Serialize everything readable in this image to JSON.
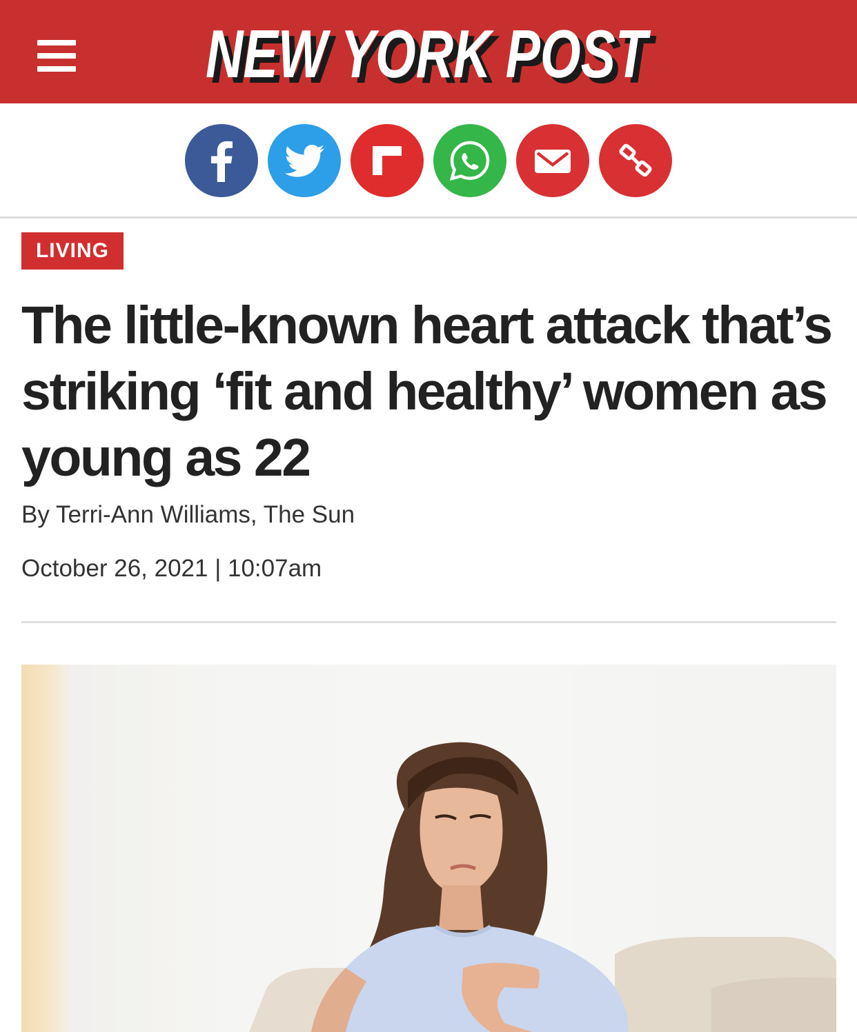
{
  "header": {
    "logo_text": "NEW YORK POST",
    "menu_icon": "hamburger-menu-icon",
    "background_color": "#c8302f"
  },
  "share": [
    {
      "name": "facebook",
      "icon": "facebook-icon",
      "color": "#3c5a98"
    },
    {
      "name": "twitter",
      "icon": "twitter-icon",
      "color": "#2d9fe9"
    },
    {
      "name": "flipboard",
      "icon": "flipboard-icon",
      "color": "#df2c2c"
    },
    {
      "name": "whatsapp",
      "icon": "whatsapp-icon",
      "color": "#34b649"
    },
    {
      "name": "email",
      "icon": "email-icon",
      "color": "#d93133"
    },
    {
      "name": "copy-link",
      "icon": "link-icon",
      "color": "#d93133"
    }
  ],
  "article": {
    "section": "LIVING",
    "headline": "The little-known heart attack that’s striking ‘fit and healthy’ women as young as 22",
    "byline_prefix": "By",
    "byline_author": "Terri-Ann Williams, The Sun",
    "date": "October 26, 2021 | 10:07am"
  },
  "image": {
    "icon": "article-photo"
  }
}
